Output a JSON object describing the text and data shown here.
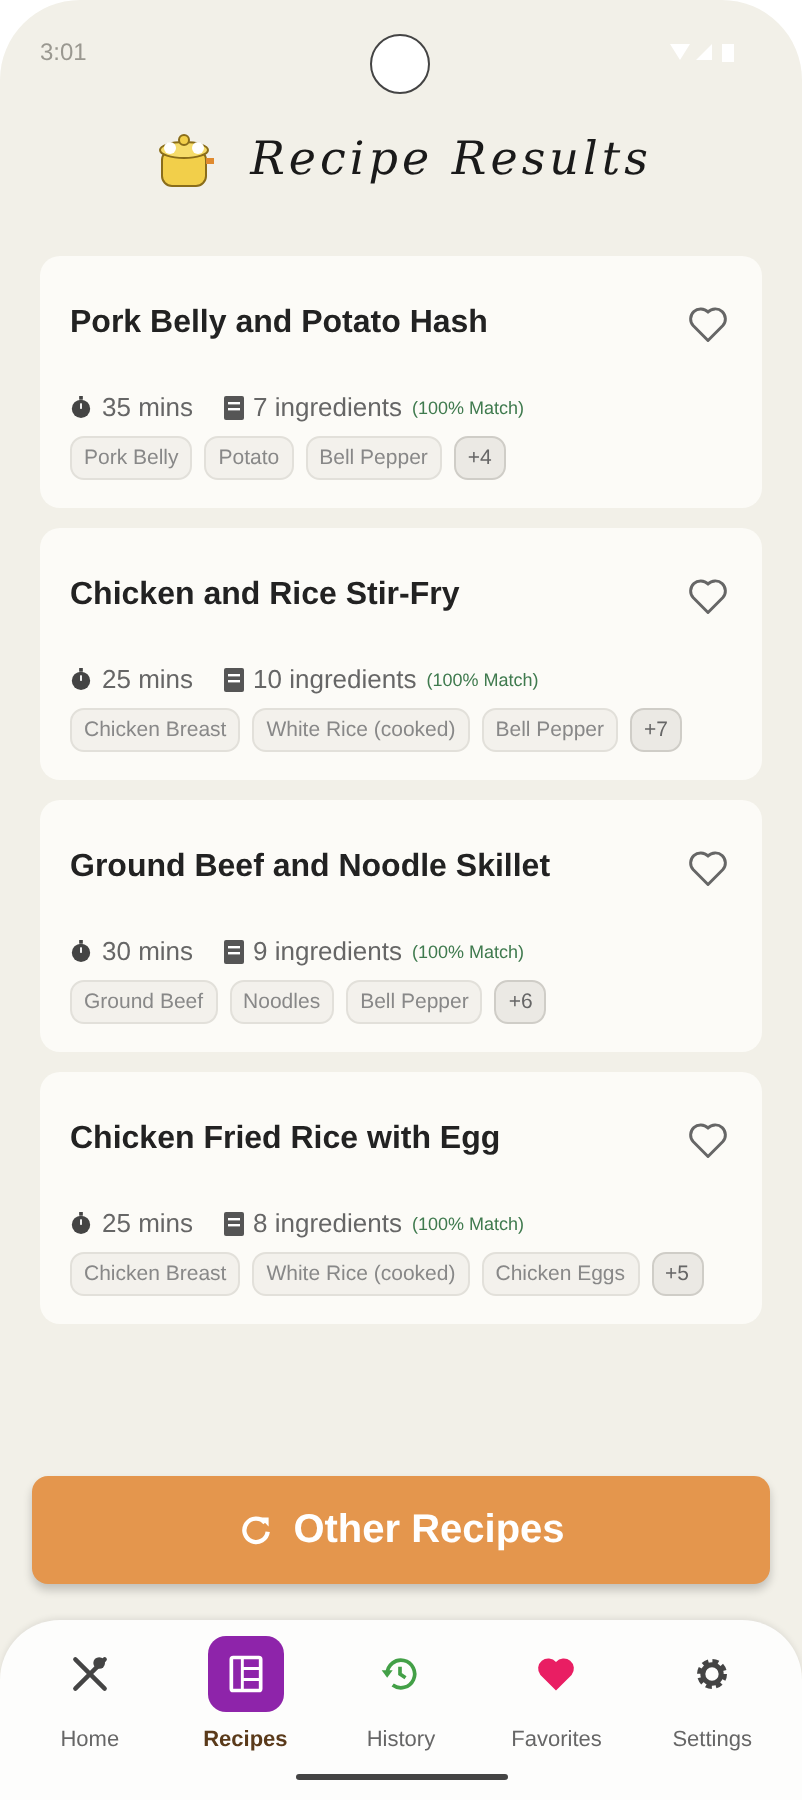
{
  "status_bar": {
    "time": "3:01"
  },
  "header": {
    "title": "Recipe Results"
  },
  "recipes": [
    {
      "title": "Pork Belly and Potato Hash",
      "favorite": false,
      "time": "35 mins",
      "ingredients": "7 ingredients",
      "match": "(100% Match)",
      "tags": [
        "Pork Belly",
        "Potato",
        "Bell Pepper"
      ],
      "more": "+4"
    },
    {
      "title": "Chicken and Rice Stir-Fry",
      "favorite": false,
      "time": "25 mins",
      "ingredients": "10 ingredients",
      "match": "(100% Match)",
      "tags": [
        "Chicken Breast",
        "White Rice (cooked)",
        "Bell Pepper"
      ],
      "more": "+7"
    },
    {
      "title": "Ground Beef and Noodle Skillet",
      "favorite": false,
      "time": "30 mins",
      "ingredients": "9 ingredients",
      "match": "(100% Match)",
      "tags": [
        "Ground Beef",
        "Noodles",
        "Bell Pepper"
      ],
      "more": "+6"
    },
    {
      "title": "Chicken Fried Rice with Egg",
      "favorite": false,
      "time": "25 mins",
      "ingredients": "8 ingredients",
      "match": "(100% Match)",
      "tags": [
        "Chicken Breast",
        "White Rice (cooked)",
        "Chicken Eggs"
      ],
      "more": "+5"
    }
  ],
  "action_button": {
    "label": "Other Recipes"
  },
  "nav": [
    {
      "kind": "home",
      "label": "Home",
      "selected": false,
      "color": "#444444"
    },
    {
      "kind": "recipes",
      "label": "Recipes",
      "selected": true,
      "color": "#8e24aa"
    },
    {
      "kind": "history",
      "label": "History",
      "selected": false,
      "color": "#43a047"
    },
    {
      "kind": "favorites",
      "label": "Favorites",
      "selected": false,
      "color": "#e91e63"
    },
    {
      "kind": "settings",
      "label": "Settings",
      "selected": false,
      "color": "#444444"
    }
  ]
}
